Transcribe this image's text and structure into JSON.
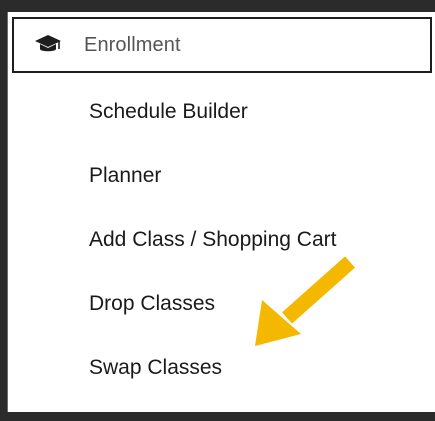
{
  "enrollment_header": {
    "label": "Enrollment",
    "icon": "graduation-cap-icon"
  },
  "menu": {
    "items": [
      {
        "label": "Schedule Builder"
      },
      {
        "label": "Planner"
      },
      {
        "label": "Add Class / Shopping Cart"
      },
      {
        "label": "Drop Classes"
      },
      {
        "label": "Swap Classes"
      }
    ]
  },
  "annotation": {
    "arrow_color": "#F5B800"
  },
  "colors": {
    "frame": "#2b2b2b",
    "header_border": "#1e1e1e",
    "text": "#1a1a1a"
  }
}
